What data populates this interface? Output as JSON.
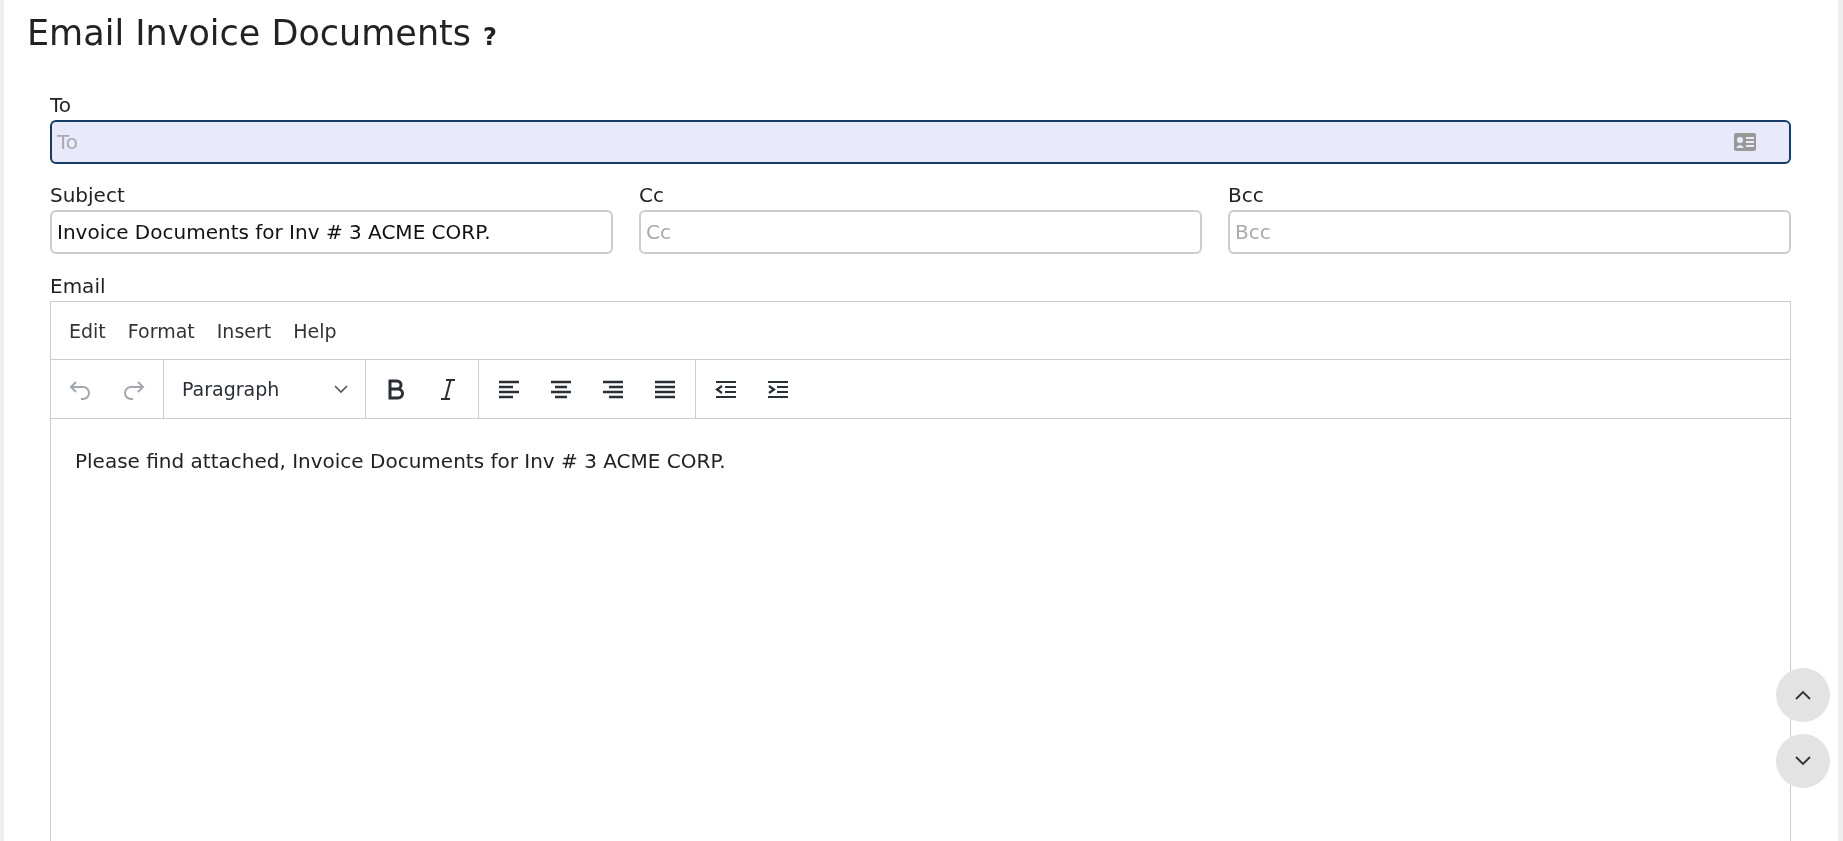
{
  "title": "Email Invoice Documents",
  "help": "?",
  "fields": [
    {
      "label": "To",
      "placeholder": "To",
      "focused": true,
      "kind": "contacts"
    },
    {
      "label": "Subject",
      "value": "Invoice Documents for Inv # 3 ACME CORP.",
      "focused": false,
      "kind": "text"
    },
    {
      "label": "Cc",
      "placeholder": "Cc",
      "focused": false,
      "kind": "text"
    },
    {
      "label": "Bcc",
      "placeholder": "Bcc",
      "focused": false,
      "kind": "text"
    }
  ],
  "editor": {
    "label": "Email",
    "menu": [
      "Edit",
      "Format",
      "Insert",
      "Help"
    ],
    "toolbar": [
      [
        {
          "kind": "undo",
          "disabled": true
        },
        {
          "kind": "redo",
          "disabled": true
        }
      ],
      [
        {
          "kind": "block",
          "text": "Paragraph",
          "disabled": false
        }
      ],
      [
        {
          "kind": "bold",
          "disabled": false
        },
        {
          "kind": "italic",
          "disabled": false
        }
      ],
      [
        {
          "kind": "align-left",
          "disabled": false
        },
        {
          "kind": "align-center",
          "disabled": false
        },
        {
          "kind": "align-right",
          "disabled": false
        },
        {
          "kind": "justify",
          "disabled": false
        }
      ],
      [
        {
          "kind": "outdent",
          "disabled": false
        },
        {
          "kind": "indent",
          "disabled": false
        }
      ]
    ],
    "body": "Please find attached, Invoice Documents for Inv # 3 ACME CORP."
  }
}
